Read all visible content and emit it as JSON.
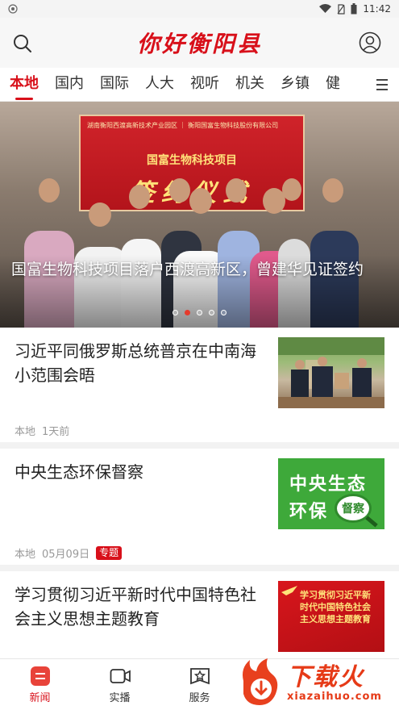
{
  "status_bar": {
    "time": "11:42"
  },
  "header": {
    "title": "你好衡阳县"
  },
  "tabs": [
    {
      "label": "本地"
    },
    {
      "label": "国内"
    },
    {
      "label": "国际"
    },
    {
      "label": "人大"
    },
    {
      "label": "视听"
    },
    {
      "label": "机关"
    },
    {
      "label": "乡镇"
    },
    {
      "label": "健"
    }
  ],
  "banner": {
    "caption": "国富生物科技项目落户西渡高新区，曾建华见证签约",
    "board_line": "湖南衡阳西渡高新技术产业园区 ｜ 衡阳国富生物科技股份有限公司",
    "board_project": "国富生物科技项目",
    "board_sign": "签约仪式",
    "slide_count": 5,
    "active_slide": 2
  },
  "news": [
    {
      "title": "习近平同俄罗斯总统普京在中南海小范围会晤",
      "source": "本地",
      "time": "1天前",
      "badge": ""
    },
    {
      "title": "中央生态环保督察",
      "source": "本地",
      "time": "05月09日",
      "badge": "专题",
      "thumb_text_1": "中央生态",
      "thumb_text_2": "环保",
      "thumb_text_3": "督察"
    },
    {
      "title": "学习贯彻习近平新时代中国特色社会主义思想主题教育",
      "thumb_text": "学习贯彻习近平新时代中国特色社会主义思想主题教育"
    }
  ],
  "bottom_nav": [
    {
      "label": "新闻",
      "icon": "news-icon"
    },
    {
      "label": "实播",
      "icon": "video-camera-icon"
    },
    {
      "label": "服务",
      "icon": "service-star-icon"
    }
  ],
  "watermark": {
    "text": "下载火",
    "domain": "xiazaihuo.com"
  },
  "colors": {
    "brand": "#d8101a",
    "green": "#3ea93a"
  }
}
